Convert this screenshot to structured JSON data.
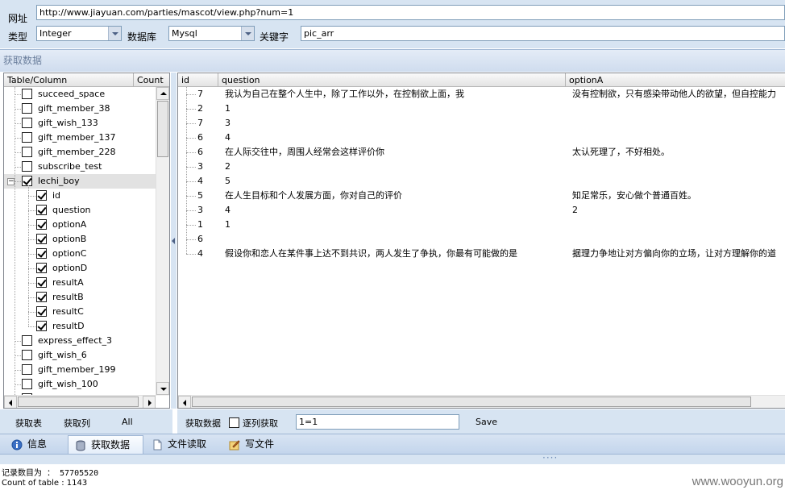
{
  "form": {
    "url_label": "网址",
    "url_value": "http://www.jiayuan.com/parties/mascot/view.php?num=1",
    "type_label": "类型",
    "type_value": "Integer",
    "db_label": "数据库",
    "db_value": "Mysql",
    "keyword_label": "关键字",
    "keyword_value": "pic_arr"
  },
  "group_title": "获取数据",
  "tree": {
    "columns": [
      "Table/Column",
      "Count"
    ],
    "items": [
      {
        "label": "succeed_space",
        "level": 0,
        "checked": false
      },
      {
        "label": "gift_member_38",
        "level": 0,
        "checked": false
      },
      {
        "label": "gift_wish_133",
        "level": 0,
        "checked": false
      },
      {
        "label": "gift_member_137",
        "level": 0,
        "checked": false
      },
      {
        "label": "gift_member_228",
        "level": 0,
        "checked": false
      },
      {
        "label": "subscribe_test",
        "level": 0,
        "checked": false
      },
      {
        "label": "lechi_boy",
        "level": 0,
        "checked": true,
        "expanded": true,
        "selected": true
      },
      {
        "label": "id",
        "level": 1,
        "checked": true
      },
      {
        "label": "question",
        "level": 1,
        "checked": true
      },
      {
        "label": "optionA",
        "level": 1,
        "checked": true
      },
      {
        "label": "optionB",
        "level": 1,
        "checked": true
      },
      {
        "label": "optionC",
        "level": 1,
        "checked": true
      },
      {
        "label": "optionD",
        "level": 1,
        "checked": true
      },
      {
        "label": "resultA",
        "level": 1,
        "checked": true
      },
      {
        "label": "resultB",
        "level": 1,
        "checked": true
      },
      {
        "label": "resultC",
        "level": 1,
        "checked": true
      },
      {
        "label": "resultD",
        "level": 1,
        "checked": true
      },
      {
        "label": "express_effect_3",
        "level": 0,
        "checked": false
      },
      {
        "label": "gift_wish_6",
        "level": 0,
        "checked": false
      },
      {
        "label": "gift_member_199",
        "level": 0,
        "checked": false
      },
      {
        "label": "gift_wish_100",
        "level": 0,
        "checked": false
      },
      {
        "label": "gift_...",
        "level": 0,
        "checked": false
      }
    ]
  },
  "grid": {
    "columns": [
      "id",
      "question",
      "optionA"
    ],
    "rows": [
      [
        "7",
        "我认为自己在整个人生中，除了工作以外，在控制欲上面，我",
        "没有控制欲，只有感染带动他人的欲望，但自控能力"
      ],
      [
        "2",
        "1",
        ""
      ],
      [
        "7",
        "3",
        ""
      ],
      [
        "6",
        "4",
        ""
      ],
      [
        "6",
        "在人际交往中，周围人经常会这样评价你",
        "太认死理了，不好相处。"
      ],
      [
        "3",
        "2",
        ""
      ],
      [
        "4",
        "5",
        ""
      ],
      [
        "5",
        "在人生目标和个人发展方面，你对自己的评价",
        "知足常乐，安心做个普通百姓。"
      ],
      [
        "3",
        "4",
        "2"
      ],
      [
        "1",
        "1",
        ""
      ],
      [
        "6",
        "",
        ""
      ],
      [
        "4",
        "假设你和恋人在某件事上达不到共识，两人发生了争执，你最有可能做的是",
        "据理力争地让对方偏向你的立场，让对方理解你的道"
      ]
    ]
  },
  "left_actions": {
    "get_tables": "获取表",
    "get_columns": "获取列",
    "all": "All"
  },
  "right_actions": {
    "get_data": "获取数据",
    "per_column": "逐列获取",
    "where_value": "1=1",
    "save": "Save"
  },
  "tabs": [
    {
      "label": "信息",
      "icon": "info-icon"
    },
    {
      "label": "获取数据",
      "icon": "database-icon",
      "active": true
    },
    {
      "label": "文件读取",
      "icon": "file-icon"
    },
    {
      "label": "写文件",
      "icon": "write-file-icon"
    }
  ],
  "status": {
    "record_count": "记录数目为 ： 57705520",
    "table_count": "Count of table : 1143"
  },
  "watermark": "www.wooyun.org",
  "colors": {
    "panel_bg": "#d7e4f2",
    "header_text": "#6a7e9c"
  }
}
